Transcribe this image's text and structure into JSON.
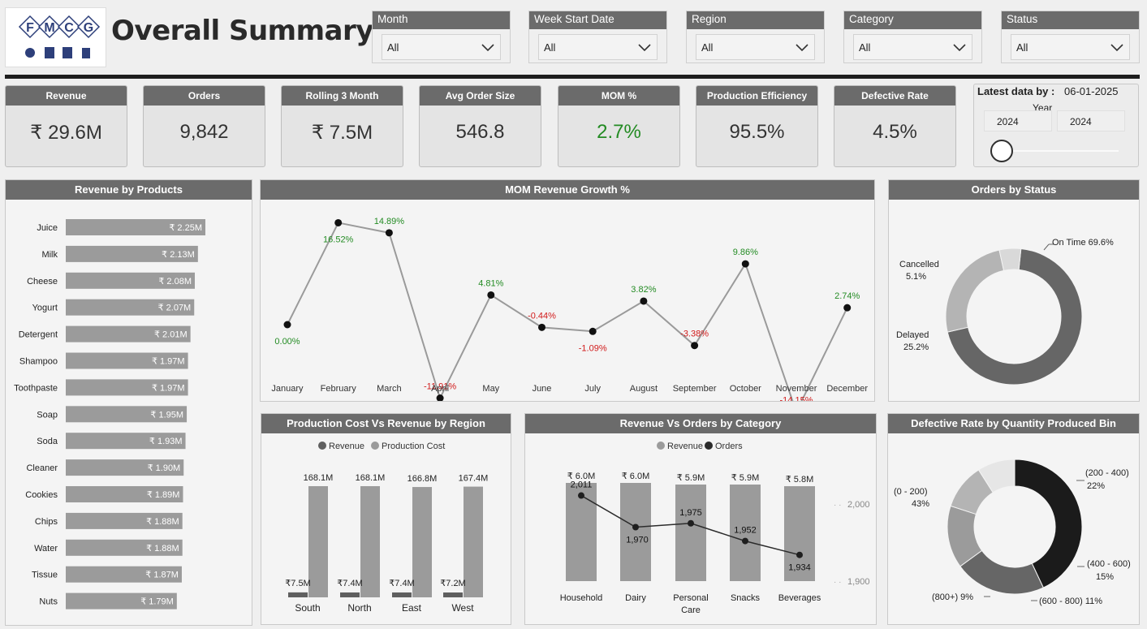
{
  "header": {
    "logo_letters": [
      "F",
      "M",
      "C",
      "G"
    ],
    "title": "Overall Summary"
  },
  "filters": [
    {
      "label": "Month",
      "value": "All"
    },
    {
      "label": "Week Start Date",
      "value": "All"
    },
    {
      "label": "Region",
      "value": "All"
    },
    {
      "label": "Category",
      "value": "All"
    },
    {
      "label": "Status",
      "value": "All"
    }
  ],
  "kpis": [
    {
      "label": "Revenue",
      "value": "₹ 29.6M"
    },
    {
      "label": "Orders",
      "value": "9,842"
    },
    {
      "label": "Rolling 3 Month",
      "value": "₹ 7.5M"
    },
    {
      "label": "Avg Order Size",
      "value": "546.8"
    },
    {
      "label": "MOM %",
      "value": "2.7%"
    },
    {
      "label": "Production Efficiency",
      "value": "95.5%"
    },
    {
      "label": "Defective Rate",
      "value": "4.5%"
    }
  ],
  "latest": {
    "label": "Latest data by :",
    "date": "06-01-2025",
    "year_label": "Year",
    "year_from": "2024",
    "year_to": "2024",
    "slider_position": 0
  },
  "colors": {
    "header_bg": "#6b6b6b",
    "positive": "#238b23",
    "negative": "#d11a1a",
    "bar_gray": "#9b9b9b",
    "dark_gray": "#5f5f5f",
    "black": "#1b1b1b"
  },
  "chart_data": [
    {
      "id": "revenue_by_products",
      "title": "Revenue by Products",
      "type": "bar",
      "orientation": "horizontal",
      "categories": [
        "Juice",
        "Milk",
        "Cheese",
        "Yogurt",
        "Detergent",
        "Shampoo",
        "Toothpaste",
        "Soap",
        "Soda",
        "Cleaner",
        "Cookies",
        "Chips",
        "Water",
        "Tissue",
        "Nuts"
      ],
      "values": [
        2.25,
        2.13,
        2.08,
        2.07,
        2.01,
        1.97,
        1.97,
        1.95,
        1.93,
        1.9,
        1.89,
        1.88,
        1.88,
        1.87,
        1.79
      ],
      "labels": [
        "₹ 2.25M",
        "₹ 2.13M",
        "₹ 2.08M",
        "₹ 2.07M",
        "₹ 2.01M",
        "₹ 1.97M",
        "₹ 1.97M",
        "₹ 1.95M",
        "₹ 1.93M",
        "₹ 1.90M",
        "₹ 1.89M",
        "₹ 1.88M",
        "₹ 1.88M",
        "₹ 1.87M",
        "₹ 1.79M"
      ]
    },
    {
      "id": "mom_growth",
      "title": "MOM Revenue Growth %",
      "type": "line",
      "categories": [
        "January",
        "February",
        "March",
        "April",
        "May",
        "June",
        "July",
        "August",
        "September",
        "October",
        "November",
        "December"
      ],
      "values": [
        0.0,
        16.52,
        14.89,
        -11.91,
        4.81,
        -0.44,
        -1.09,
        3.82,
        -3.38,
        9.86,
        -14.15,
        2.74
      ],
      "labels": [
        "0.00%",
        "16.52%",
        "14.89%",
        "-11.91%",
        "4.81%",
        "-0.44%",
        "-1.09%",
        "3.82%",
        "-3.38%",
        "9.86%",
        "-14.15%",
        "2.74%"
      ]
    },
    {
      "id": "orders_by_status",
      "title": "Orders by Status",
      "type": "pie",
      "donut": true,
      "categories": [
        "On Time",
        "Delayed",
        "Cancelled"
      ],
      "values": [
        69.6,
        25.2,
        5.1
      ],
      "labels": [
        "On Time 69.6%",
        "Delayed",
        "Cancelled"
      ],
      "pct_labels": [
        "",
        "25.2%",
        "5.1%"
      ],
      "colors": [
        "#666666",
        "#b4b4b4",
        "#d9d9d9"
      ]
    },
    {
      "id": "cost_vs_revenue_region",
      "title": "Production Cost Vs Revenue by Region",
      "type": "bar",
      "categories": [
        "South",
        "North",
        "East",
        "West"
      ],
      "series": [
        {
          "name": "Revenue",
          "values": [
            7.5,
            7.4,
            7.4,
            7.2
          ],
          "labels": [
            "₹7.5M",
            "₹7.4M",
            "₹7.4M",
            "₹7.2M"
          ],
          "color": "#5f5f5f"
        },
        {
          "name": "Production Cost",
          "values": [
            168.1,
            168.1,
            166.8,
            167.4
          ],
          "labels": [
            "168.1M",
            "168.1M",
            "166.8M",
            "167.4M"
          ],
          "color": "#9b9b9b"
        }
      ],
      "ylim": [
        0,
        180
      ]
    },
    {
      "id": "revenue_vs_orders_category",
      "title": "Revenue Vs Orders by Category",
      "type": "bar",
      "categories": [
        "Household",
        "Dairy",
        "Personal Care",
        "Snacks",
        "Beverages"
      ],
      "series": [
        {
          "name": "Revenue",
          "values": [
            6.0,
            6.0,
            5.9,
            5.9,
            5.8
          ],
          "labels": [
            "₹ 6.0M",
            "₹ 6.0M",
            "₹ 5.9M",
            "₹ 5.9M",
            "₹ 5.8M"
          ],
          "color": "#9b9b9b"
        },
        {
          "name": "Orders",
          "values": [
            2011,
            1970,
            1975,
            1952,
            1934
          ],
          "labels": [
            "2,011",
            "1,970",
            "1,975",
            "1,952",
            "1,934"
          ],
          "color": "#2b2b2b"
        }
      ],
      "y2_ticks": [
        "2,000",
        "1,900"
      ],
      "y2_range": [
        1900,
        2000
      ]
    },
    {
      "id": "defective_rate_bins",
      "title": "Defective Rate by Quantity Produced Bin",
      "type": "pie",
      "donut": true,
      "categories": [
        "(0 - 200)",
        "(200 - 400)",
        "(400 - 600)",
        "(600 - 800)",
        "(800+)"
      ],
      "values": [
        43,
        22,
        15,
        11,
        9
      ],
      "labels": [
        "(0 - 200)",
        "(200 - 400)",
        "(400 - 600)",
        "(600 - 800) 11%",
        "(800+) 9%"
      ],
      "pct_labels": [
        "43%",
        "22%",
        "15%",
        "",
        ""
      ],
      "colors": [
        "#1b1b1b",
        "#666666",
        "#9b9b9b",
        "#b4b4b4",
        "#e6e6e6"
      ]
    }
  ]
}
